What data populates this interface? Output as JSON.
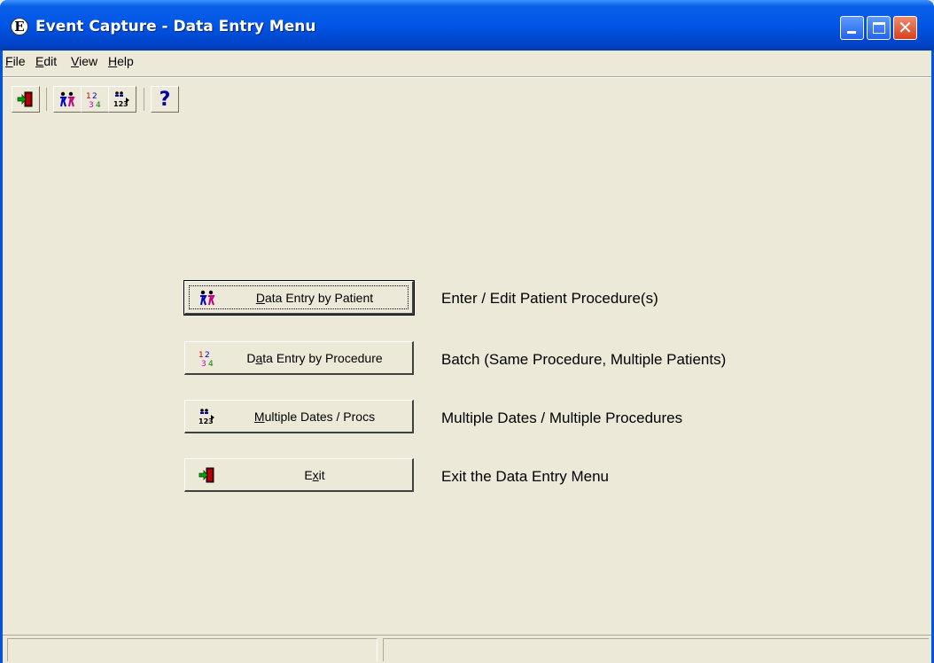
{
  "window": {
    "title": "Event Capture - Data Entry Menu",
    "app_icon_letter": "E"
  },
  "menu": [
    {
      "label": "File",
      "accel": "F",
      "rest": "ile"
    },
    {
      "label": "Edit",
      "accel": "E",
      "rest": "dit"
    },
    {
      "label": "View",
      "accel": "V",
      "rest": "iew"
    },
    {
      "label": "Help",
      "accel": "H",
      "rest": "elp"
    }
  ],
  "toolbar": {
    "exit_icon": "exit-door-icon",
    "patient_icon": "patients-icon",
    "procedure_icon": "procedure-numbers-icon",
    "multiple_icon": "multiple-dates-icon",
    "help_label": "?"
  },
  "main": {
    "buttons": [
      {
        "pre": "",
        "accel": "D",
        "rest": "ata Entry by Patient",
        "description": "Enter / Edit Patient Procedure(s)",
        "icon": "patients-icon"
      },
      {
        "pre": "D",
        "accel": "a",
        "rest": "ta Entry by Procedure",
        "description": "Batch (Same Procedure, Multiple Patients)",
        "icon": "procedure-numbers-icon"
      },
      {
        "pre": "",
        "accel": "M",
        "rest": "ultiple Dates / Procs",
        "description": "Multiple Dates / Multiple Procedures",
        "icon": "multiple-dates-icon"
      },
      {
        "pre": "E",
        "accel": "x",
        "rest": "it",
        "description": "Exit the Data Entry Menu",
        "icon": "exit-door-icon"
      }
    ]
  },
  "colors": {
    "titlebar": "#0055E5",
    "face": "#ECE9D8",
    "close_button": "#D8401E"
  }
}
